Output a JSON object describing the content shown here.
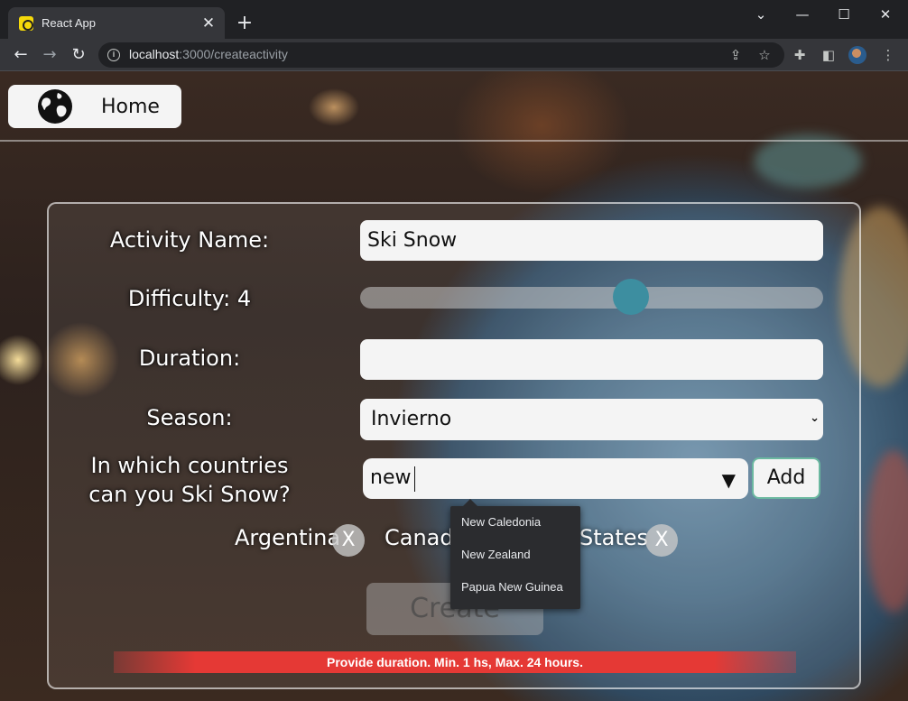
{
  "browser": {
    "tab_title": "React App",
    "tab_close": "✕",
    "new_tab": "+",
    "url_host": "localhost",
    "url_path": ":3000/createactivity",
    "controls": {
      "minimize": "—",
      "maximize": "☐",
      "close": "✕"
    }
  },
  "nav": {
    "home_label": "Home"
  },
  "form": {
    "activity_name": {
      "label": "Activity Name:",
      "value": "Ski Snow"
    },
    "difficulty": {
      "label": "Difficulty: 4",
      "value": 4,
      "min": 1,
      "max": 5
    },
    "duration": {
      "label": "Duration:",
      "value": ""
    },
    "season": {
      "label": "Season:",
      "value": "Invierno"
    },
    "countries": {
      "label_line1": "In which countries",
      "label_line2": "can you Ski Snow?",
      "input_value": "new",
      "add_label": "Add"
    },
    "selected_countries": [
      {
        "name": "Argentina",
        "remove_label": "X"
      },
      {
        "name": "Canada",
        "remove_label": "X"
      },
      {
        "name": "States",
        "remove_label": "X"
      }
    ],
    "create_label": "Create",
    "error_message": "Provide duration. Min. 1 hs, Max. 24 hours."
  },
  "autocomplete": {
    "options": [
      "New Caledonia",
      "New Zealand",
      "Papua New Guinea"
    ]
  },
  "colors": {
    "accent": "#3d8ea0",
    "error": "#e53935",
    "add_border": "#6bb8a0"
  }
}
